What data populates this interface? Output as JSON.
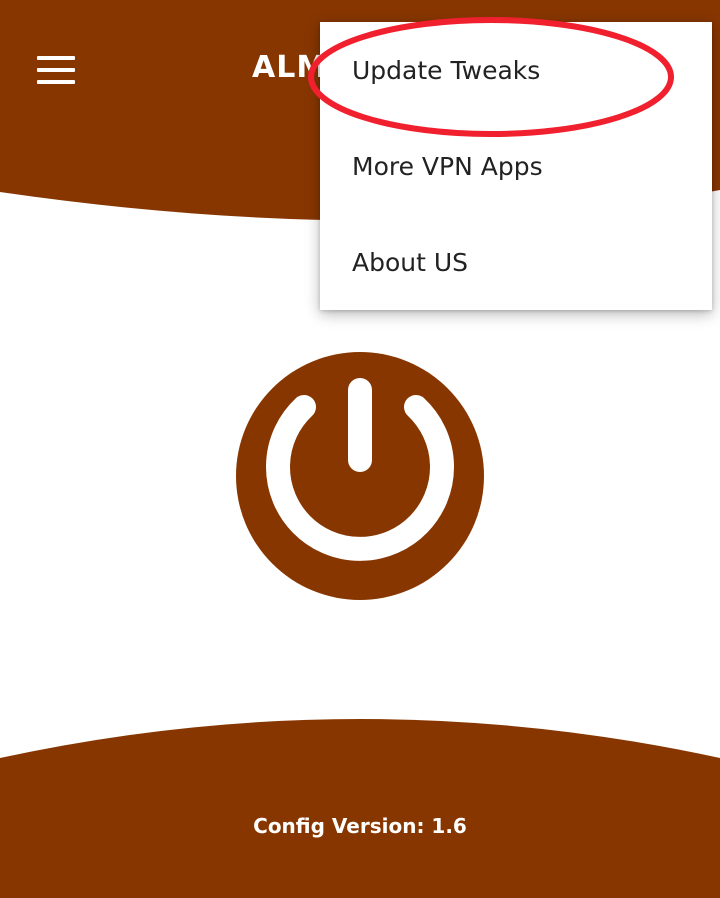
{
  "app": {
    "title": "ALM",
    "primary_color": "#873600",
    "background_color": "#ffffff"
  },
  "header": {
    "menu_icon": "hamburger-menu-icon"
  },
  "dropdown": {
    "items": [
      {
        "label": "Update Tweaks"
      },
      {
        "label": "More VPN Apps"
      },
      {
        "label": "About US"
      }
    ],
    "highlight_color": "#f0202e"
  },
  "main": {
    "power_icon": "power-icon"
  },
  "footer": {
    "config_version": "Config Version: 1.6"
  }
}
